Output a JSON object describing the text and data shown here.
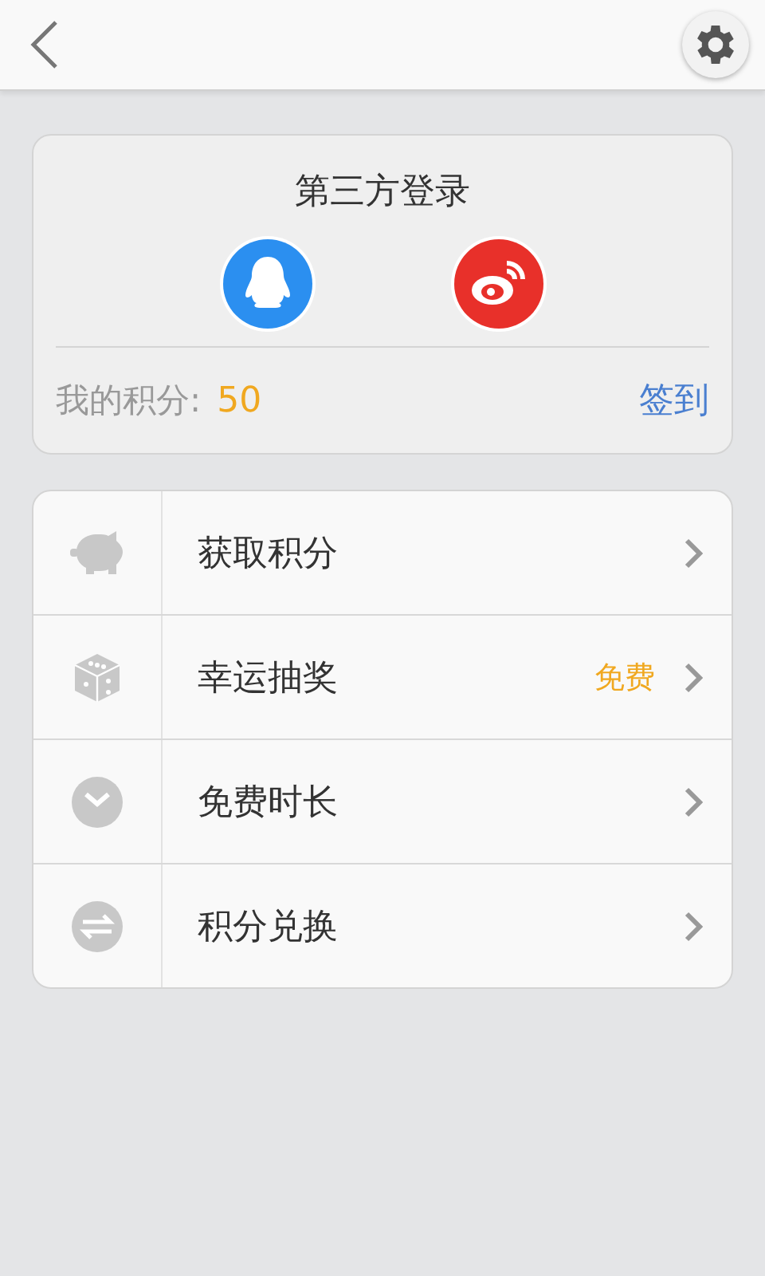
{
  "login": {
    "title": "第三方登录",
    "points_label": "我的积分:",
    "points_value": "50",
    "checkin": "签到"
  },
  "menu": [
    {
      "label": "获取积分"
    },
    {
      "label": "幸运抽奖",
      "badge": "免费"
    },
    {
      "label": "免费时长"
    },
    {
      "label": "积分兑换"
    }
  ]
}
